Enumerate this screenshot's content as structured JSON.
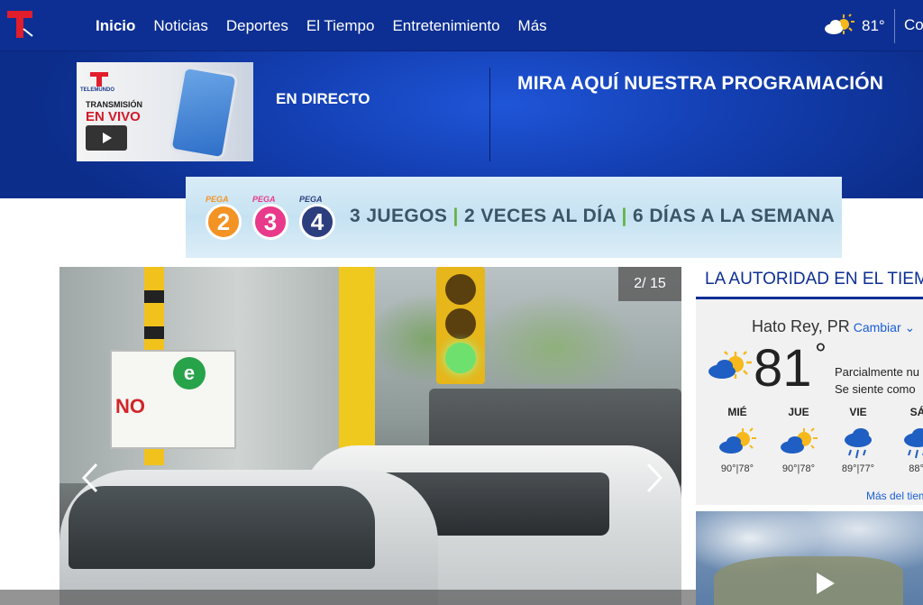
{
  "nav": {
    "items": [
      {
        "label": "Inicio",
        "active": true
      },
      {
        "label": "Noticias"
      },
      {
        "label": "Deportes"
      },
      {
        "label": "El Tiempo"
      },
      {
        "label": "Entretenimiento"
      },
      {
        "label": "Más"
      }
    ],
    "weather_temp": "81°",
    "weather_icon": "partly-cloudy-icon",
    "truncated_right": "Co"
  },
  "hero": {
    "promo": {
      "line1": "TRANSMISIÓN",
      "line2": "EN VIVO",
      "brand": "TELEMUNDO"
    },
    "live_label": "EN DIRECTO",
    "schedule_label": "MIRA AQUÍ NUESTRA PROGRAMACIÓN"
  },
  "ad": {
    "tag": "PEGA",
    "balls": [
      "2",
      "3",
      "4"
    ],
    "text_a": "3 JUEGOS",
    "sep": "|",
    "text_b": "2 VECES AL DÍA",
    "text_c": "6 DÍAS A LA SEMANA"
  },
  "slideshow": {
    "counter": "2/ 15",
    "sign_no": "NO",
    "sign_e": "e"
  },
  "weather": {
    "title": "LA AUTORIDAD EN EL TIEMPO",
    "location": "Hato Rey, PR",
    "change": "Cambiar ⌄",
    "temp": "81",
    "deg": "°",
    "desc_line1": "Parcialmente nu",
    "desc_line2": "Se siente como",
    "days": [
      {
        "name": "MIÉ",
        "icon": "partly-cloudy-icon",
        "hilo": "90°|78°"
      },
      {
        "name": "JUE",
        "icon": "partly-cloudy-icon",
        "hilo": "90°|78°"
      },
      {
        "name": "VIE",
        "icon": "rain-icon",
        "hilo": "89°|77°"
      },
      {
        "name": "SÁ",
        "icon": "rain-icon",
        "hilo": "88°|"
      }
    ],
    "more_link": "Más del tiem"
  },
  "colors": {
    "nav_bg": "#0d2f93",
    "accent_blue": "#1a5ed8",
    "ad_green": "#62b33f",
    "pega_orange": "#f39323",
    "pega_pink": "#e8398a",
    "pega_navy": "#2c3e7e"
  }
}
